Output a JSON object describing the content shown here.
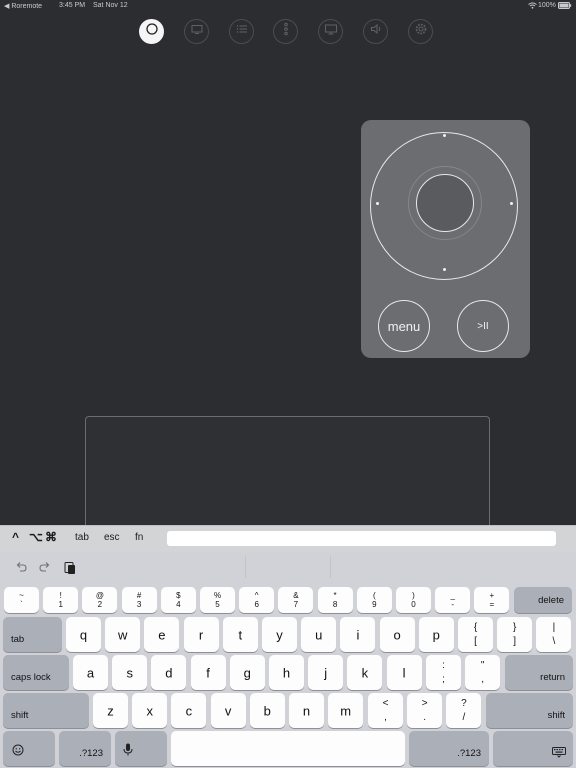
{
  "status_bar": {
    "back_label": "◀ Roremote",
    "time": "3:45 PM",
    "date": "Sat Nov 12",
    "battery": "100%"
  },
  "toolbar": {
    "buttons": [
      {
        "name": "remote-tab",
        "icon": "circle-icon",
        "active": true
      },
      {
        "name": "screen-tab",
        "icon": "monitor-icon"
      },
      {
        "name": "list-tab",
        "icon": "list-icon"
      },
      {
        "name": "more-tab",
        "icon": "more-vertical-icon"
      },
      {
        "name": "display-tab",
        "icon": "display-icon"
      },
      {
        "name": "volume-tab",
        "icon": "speaker-icon"
      },
      {
        "name": "settings-tab",
        "icon": "gear-icon"
      }
    ]
  },
  "remote": {
    "menu_label": "menu",
    "play_pause_label": ">II"
  },
  "accessory_bar": {
    "ctrl": "^",
    "option": "⌥",
    "command": "⌘",
    "tab": "tab",
    "esc": "esc",
    "fn": "fn",
    "input_value": ""
  },
  "keyboard": {
    "number_row": [
      {
        "top": "~",
        "bottom": "`"
      },
      {
        "top": "!",
        "bottom": "1"
      },
      {
        "top": "@",
        "bottom": "2"
      },
      {
        "top": "#",
        "bottom": "3"
      },
      {
        "top": "$",
        "bottom": "4"
      },
      {
        "top": "%",
        "bottom": "5"
      },
      {
        "top": "^",
        "bottom": "6"
      },
      {
        "top": "&",
        "bottom": "7"
      },
      {
        "top": "*",
        "bottom": "8"
      },
      {
        "top": "(",
        "bottom": "9"
      },
      {
        "top": ")",
        "bottom": "0"
      },
      {
        "top": "_",
        "bottom": "-"
      },
      {
        "top": "+",
        "bottom": "="
      }
    ],
    "delete": "delete",
    "tab": "tab",
    "row1": [
      "q",
      "w",
      "e",
      "r",
      "t",
      "y",
      "u",
      "i",
      "o",
      "p"
    ],
    "row1_sym": [
      {
        "top": "{",
        "bottom": "["
      },
      {
        "top": "}",
        "bottom": "]"
      },
      {
        "top": "|",
        "bottom": "\\"
      }
    ],
    "caps_lock": "caps lock",
    "row2": [
      "a",
      "s",
      "d",
      "f",
      "g",
      "h",
      "j",
      "k",
      "l"
    ],
    "row2_sym": [
      {
        "top": ":",
        "bottom": ";"
      },
      {
        "top": "\"",
        "bottom": ","
      }
    ],
    "return": "return",
    "shift": "shift",
    "row3": [
      "z",
      "x",
      "c",
      "v",
      "b",
      "n",
      "m"
    ],
    "row3_sym": [
      {
        "top": "<",
        "bottom": ","
      },
      {
        "top": ">",
        "bottom": "."
      },
      {
        "top": "?",
        "bottom": "/"
      }
    ],
    "numbers_key": ".?123",
    "emoji_icon": "emoji-icon",
    "mic_icon": "microphone-icon",
    "hide_icon": "keyboard-hide-icon"
  }
}
